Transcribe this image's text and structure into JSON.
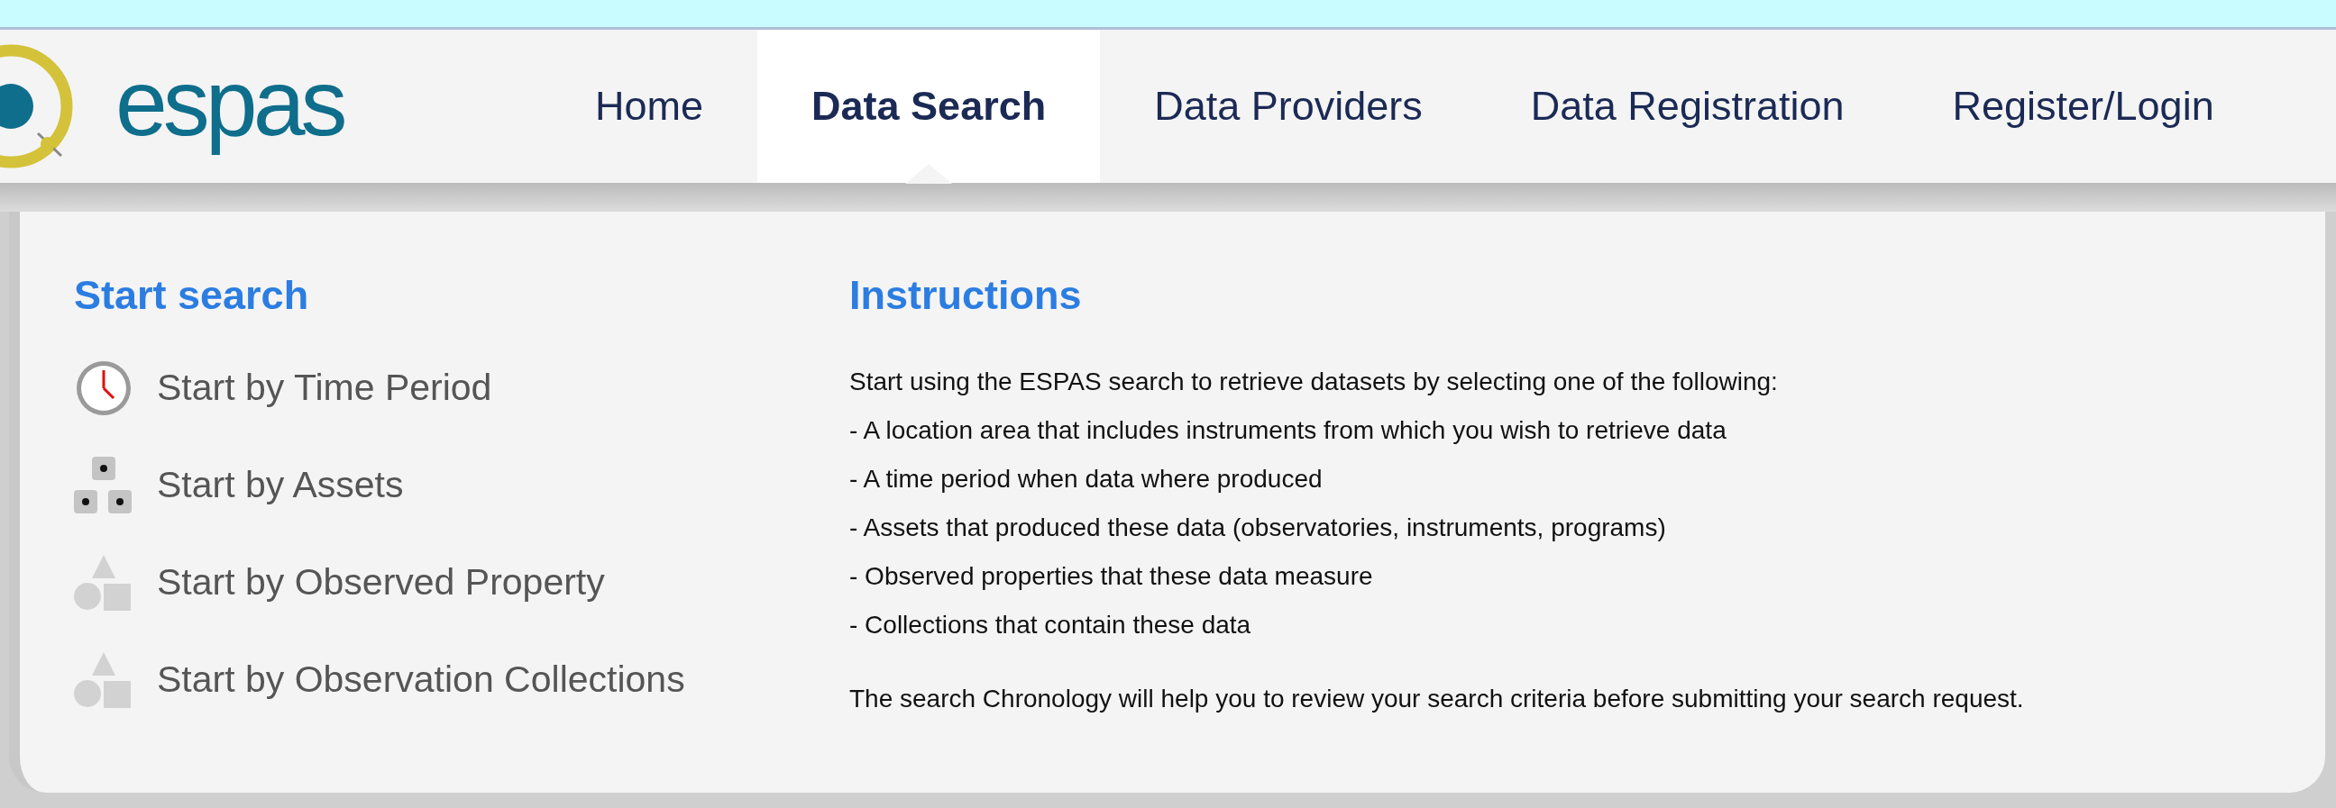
{
  "logo": {
    "text": "espas"
  },
  "nav": [
    {
      "label": "Home",
      "selected": false
    },
    {
      "label": "Data Search",
      "selected": true
    },
    {
      "label": "Data Providers",
      "selected": false
    },
    {
      "label": "Data Registration",
      "selected": false
    },
    {
      "label": "Register/Login",
      "selected": false
    }
  ],
  "start_search": {
    "title": "Start search",
    "items": [
      {
        "label": "Start by Time Period",
        "kind": "clock",
        "disabled": false
      },
      {
        "label": "Start by Assets",
        "kind": "assets",
        "disabled": false
      },
      {
        "label": "Start by Observed Property",
        "kind": "shapes",
        "disabled": true
      },
      {
        "label": "Start by Observation Collections",
        "kind": "shapes",
        "disabled": true
      }
    ]
  },
  "instructions": {
    "title": "Instructions",
    "lines": [
      "Start using the ESPAS search to retrieve datasets by selecting one of the following:",
      "- A location area that includes instruments from which you wish to retrieve data",
      "- A time period when data where produced",
      "- Assets that produced these data (observatories, instruments, programs)",
      "- Observed properties that these data measure",
      "- Collections that contain these data"
    ],
    "note": "The search Chronology will help you to review your search criteria before submitting your search request."
  }
}
